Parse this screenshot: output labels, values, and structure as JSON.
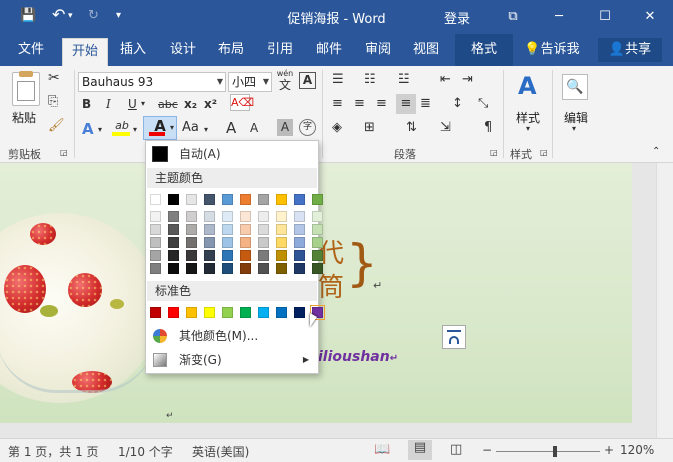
{
  "titlebar": {
    "title": "促销海报 - Word",
    "login": "登录",
    "save_icon": "💾",
    "undo_icon": "↶",
    "redo_icon": "↻",
    "qat_more": "▾",
    "ribbon_display_icon": "⧉",
    "minimize": "─",
    "maximize": "☐",
    "close": "✕"
  },
  "tabs": [
    {
      "label": "文件"
    },
    {
      "label": "开始"
    },
    {
      "label": "插入"
    },
    {
      "label": "设计"
    },
    {
      "label": "布局"
    },
    {
      "label": "引用"
    },
    {
      "label": "邮件"
    },
    {
      "label": "审阅"
    },
    {
      "label": "视图"
    },
    {
      "label": "格式"
    }
  ],
  "tell_me": "告诉我",
  "share": "共享",
  "ribbon": {
    "clipboard": {
      "paste": "粘贴",
      "group": "剪贴板"
    },
    "font": {
      "font_name": "Bauhaus 93",
      "font_size": "小四",
      "phonetic_top": "wén",
      "phonetic_bottom": "文",
      "char_border": "A",
      "bold": "B",
      "italic": "I",
      "underline": "U",
      "strike": "abc",
      "subscript": "x₂",
      "superscript": "x²",
      "text_effect": "A",
      "highlight": "ab",
      "font_color": "A",
      "change_case": "Aa",
      "grow": "A",
      "shrink": "A",
      "char_shading": "A",
      "enclose": "字"
    },
    "paragraph": {
      "group": "段落"
    },
    "styles": {
      "label": "样式",
      "group": "样式"
    },
    "editing": {
      "label": "编辑"
    }
  },
  "color_menu": {
    "automatic": "自动(A)",
    "theme_header": "主题颜色",
    "standard_header": "标准色",
    "more_colors": "其他颜色(M)...",
    "gradient": "渐变(G)",
    "theme_colors": [
      "#ffffff",
      "#000000",
      "#e7e6e6",
      "#44546a",
      "#5b9bd5",
      "#ed7d31",
      "#a5a5a5",
      "#ffc000",
      "#4472c4",
      "#70ad47"
    ],
    "theme_shades": [
      [
        "#f2f2f2",
        "#7f7f7f",
        "#d0cece",
        "#d6dce4",
        "#deebf6",
        "#fbe5d5",
        "#ededed",
        "#fff2cc",
        "#d9e2f3",
        "#e2efd9"
      ],
      [
        "#d8d8d8",
        "#595959",
        "#aeabab",
        "#adb9ca",
        "#bdd7ee",
        "#f7cbac",
        "#dbdbdb",
        "#fee599",
        "#b4c6e7",
        "#c5e0b3"
      ],
      [
        "#bfbfbf",
        "#3f3f3f",
        "#757070",
        "#8496b0",
        "#9dc3e6",
        "#f4b183",
        "#c9c9c9",
        "#ffd965",
        "#8eaadb",
        "#a8d08d"
      ],
      [
        "#a5a5a5",
        "#262626",
        "#3a3838",
        "#323f4f",
        "#2e75b5",
        "#c55a11",
        "#7b7b7b",
        "#bf9000",
        "#2f5496",
        "#538135"
      ],
      [
        "#7f7f7f",
        "#0c0c0c",
        "#171616",
        "#222a35",
        "#1e4e79",
        "#833c0b",
        "#525252",
        "#7f6000",
        "#1f3864",
        "#375623"
      ]
    ],
    "standard_colors": [
      "#c00000",
      "#ff0000",
      "#ffc000",
      "#ffff00",
      "#92d050",
      "#00b050",
      "#00b0f0",
      "#0070c0",
      "#002060",
      "#7030a0"
    ]
  },
  "document": {
    "title_line1": "代",
    "title_line2": "筒",
    "brace": "}",
    "pilcrow": "↵",
    "website": "ilioushan",
    "website_mark": "↵"
  },
  "statusbar": {
    "page": "第 1 页，共 1 页",
    "words": "1/10 个字",
    "language": "英语(美国)",
    "zoom": "120%",
    "zoom_level": 0.55
  }
}
